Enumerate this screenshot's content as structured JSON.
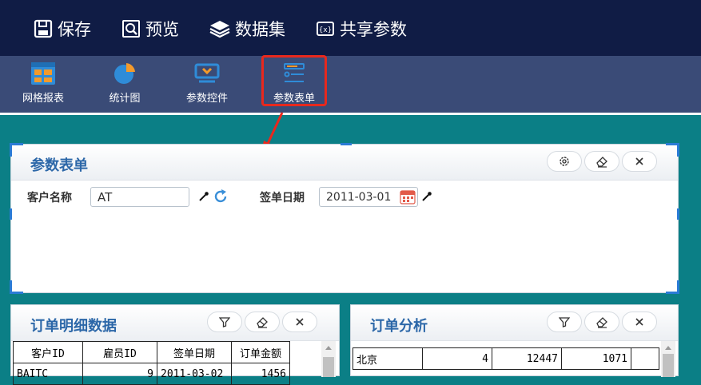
{
  "topbar": {
    "save": "保存",
    "preview": "预览",
    "dataset": "数据集",
    "share_params": "共享参数"
  },
  "toolbar": {
    "grid_report": "网格报表",
    "stat_chart": "统计图",
    "param_control": "参数控件",
    "param_form": "参数表单"
  },
  "param_panel": {
    "title": "参数表单",
    "customer_label": "客户名称",
    "customer_value": "AT",
    "date_label": "签单日期",
    "date_value": "2011-03-01"
  },
  "order_detail": {
    "title": "订单明细数据",
    "headers": [
      "客户ID",
      "雇员ID",
      "签单日期",
      "订单金额"
    ],
    "rows": [
      [
        "BAITC",
        "9",
        "2011-03-02",
        "1456"
      ]
    ]
  },
  "order_analysis": {
    "title": "订单分析",
    "rows": [
      [
        "北京",
        "4",
        "12447",
        "1071",
        ""
      ]
    ]
  },
  "colors": {
    "accent": "#2c67a8",
    "highlight": "#e8281d",
    "topbar": "#101c45",
    "toolbar": "#3a4b77",
    "background": "#0b7f86"
  }
}
